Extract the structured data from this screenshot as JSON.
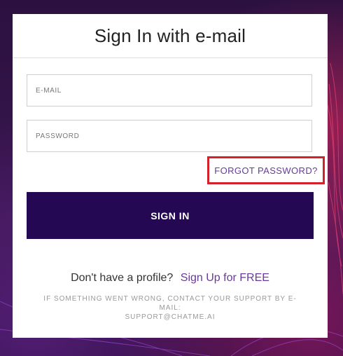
{
  "card": {
    "title": "Sign In with e-mail"
  },
  "form": {
    "email_placeholder": "E-MAIL",
    "password_placeholder": "PASSWORD",
    "forgot_password_label": "FORGOT PASSWORD?",
    "sign_in_label": "SIGN IN"
  },
  "signup": {
    "prompt": "Don't have a profile?",
    "link_label": "Sign Up for FREE"
  },
  "support": {
    "line1": "IF SOMETHING WENT WRONG, CONTACT YOUR SUPPORT BY E-MAIL:",
    "line2": "SUPPORT@CHATME.AI"
  },
  "colors": {
    "accent": "#250854",
    "link": "#6a3a9a",
    "highlight_border": "#d6202a"
  }
}
